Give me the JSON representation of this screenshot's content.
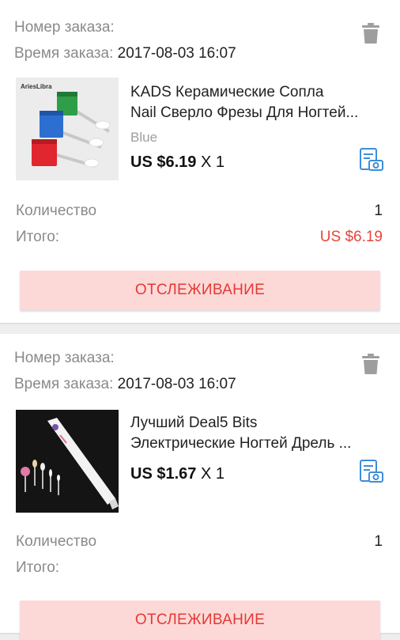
{
  "orders": [
    {
      "order_number_label": "Номер заказа:",
      "order_time_label": "Время заказа:",
      "order_time_value": "2017-08-03 16:07",
      "thumb_brand": "AriesLibra",
      "title_line1": "KADS Керамические Сопла",
      "title_line2": "Nail Сверло Фрезы Для Ногтей...",
      "variant": "Blue",
      "price": "US $6.19",
      "qty_mult": "X 1",
      "quantity_label": "Количество",
      "quantity_value": "1",
      "total_label": "Итого:",
      "total_value": "US $6.19",
      "track_label": "ОТСЛЕЖИВАНИЕ"
    },
    {
      "order_number_label": "Номер заказа:",
      "order_time_label": "Время заказа:",
      "order_time_value": "2017-08-03 16:07",
      "title_line1": "Лучший Deal5 Bits",
      "title_line2": "Электрические Ногтей Дрель ...",
      "price": "US $1.67",
      "qty_mult": "X 1",
      "quantity_label": "Количество",
      "quantity_value": "1",
      "total_label": "Итого:",
      "track_label": "ОТСЛЕЖИВАНИЕ"
    }
  ],
  "colors": {
    "accent_red": "#e53935",
    "button_bg": "#fcd9d7",
    "icon_blue": "#3d8ed9",
    "trash_gray": "#9e9e9e"
  },
  "icons": {
    "delete": "trash-icon",
    "snapshot": "order-snapshot-icon"
  }
}
